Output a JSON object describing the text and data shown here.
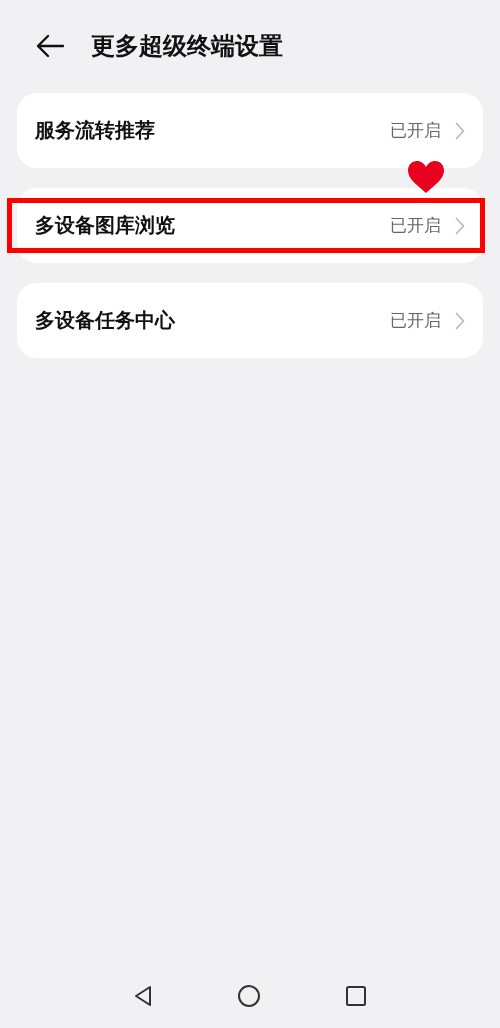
{
  "header": {
    "title": "更多超级终端设置"
  },
  "items": [
    {
      "label": "服务流转推荐",
      "status": "已开启",
      "highlighted": false
    },
    {
      "label": "多设备图库浏览",
      "status": "已开启",
      "highlighted": true
    },
    {
      "label": "多设备任务中心",
      "status": "已开启",
      "highlighted": false
    }
  ]
}
